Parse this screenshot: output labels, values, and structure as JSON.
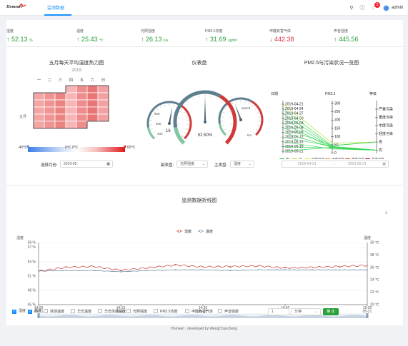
{
  "header": {
    "brand": "Homeeri",
    "nav_tab": "监测数据",
    "user": "admin",
    "notif_count": "5"
  },
  "metrics": [
    {
      "label": "湿度",
      "value": "52.13",
      "unit": "%",
      "trend": "up"
    },
    {
      "label": "温度",
      "value": "25.43",
      "unit": "℃",
      "trend": "up"
    },
    {
      "label": "光照强度",
      "value": "26.13",
      "unit": "lux",
      "trend": "up"
    },
    {
      "label": "PM2.5浓度",
      "value": "31.69",
      "unit": "ug/m³",
      "trend": "up"
    },
    {
      "label": "甲醛有害气体",
      "value": "442.38",
      "unit": "",
      "trend": "down"
    },
    {
      "label": "声音强度",
      "value": "445.56",
      "unit": "",
      "trend": "up"
    }
  ],
  "heatmap": {
    "title": "五月每天平均温度热力图",
    "year": "2019",
    "weekdays": [
      "一",
      "二",
      "三",
      "四",
      "五",
      "六",
      "日"
    ],
    "month_label": "五月",
    "legend_min": "-40℃",
    "legend_mid": "0℃ 0℃",
    "legend_max": "60℃",
    "select_label": "选择月份:",
    "month_value": "2019-05"
  },
  "gauge": {
    "title": "仪表盘",
    "main_value": "52.50%",
    "left_value": "16",
    "right_label": "speed",
    "right_unit": "km",
    "left_ticks": [
      "800",
      "600",
      "400"
    ],
    "sub_label": "副表盘:",
    "sub_value": "光照强度",
    "main_label": "主表盘:",
    "main_select": "湿度"
  },
  "pm": {
    "title": "PM2.5与污染状况一览图",
    "col_date": "日期",
    "col_pm": "PM2.5",
    "col_level": "等级",
    "dates": [
      "2019-04-21",
      "2019-04-24",
      "2019-04-27",
      "2019-04-30",
      "2019-05-03",
      "2019-05-06",
      "2019-05-09",
      "2019-05-12",
      "2019-05-15",
      "2019-05-18",
      "2019-05-21"
    ],
    "pm_ticks": [
      "300",
      "250",
      "200",
      "150",
      "100",
      "50",
      "0"
    ],
    "levels": [
      "严重污染",
      "重度污染",
      "中度污染",
      "轻度污染",
      "良",
      "优"
    ],
    "legend": [
      {
        "name": "优",
        "color": "#28d14a"
      },
      {
        "name": "良",
        "color": "#a8e61d"
      },
      {
        "name": "轻度污染",
        "color": "#f5e71c"
      },
      {
        "name": "中度污染",
        "color": "#f28e1b"
      },
      {
        "name": "重度污染",
        "color": "#e8411d"
      },
      {
        "name": "严重污染",
        "color": "#c0121b"
      }
    ],
    "date_start": "2019-04-21",
    "date_end": "2019-05-21",
    "date_sep": "→"
  },
  "line": {
    "title": "监测数据折线图",
    "legend": [
      "湿度",
      "温度"
    ],
    "left_axis_name": "湿度",
    "right_axis_name": "温度",
    "left_ticks": [
      "58 %",
      "57 %",
      "54 %",
      "51 %",
      "48 %",
      "45 %"
    ],
    "right_ticks": [
      "30 ℃",
      "28 ℃",
      "26 ℃",
      "24 ℃",
      "22 ℃",
      "20 ℃"
    ],
    "x_ticks": [
      {
        "t": "14:00",
        "d": "05-21"
      },
      {
        "t": "14:15",
        "d": "05-21"
      },
      {
        "t": "14:30",
        "d": "05-21"
      },
      {
        "t": "14:45",
        "d": "05-21"
      },
      {
        "t": "15:00",
        "d": "05-21"
      }
    ]
  },
  "chart_data": {
    "type": "line",
    "x": [
      "14:00",
      "14:05",
      "14:10",
      "14:15",
      "14:20",
      "14:25",
      "14:30",
      "14:35",
      "14:40",
      "14:45",
      "14:50",
      "14:55",
      "15:00"
    ],
    "series": [
      {
        "name": "湿度",
        "color": "#c23531",
        "values": [
          52.0,
          52.8,
          53.0,
          52.2,
          52.7,
          53.3,
          52.9,
          53.0,
          53.1,
          52.7,
          52.8,
          53.0,
          53.2
        ]
      },
      {
        "name": "温度",
        "color": "#5a7f96",
        "values": [
          25.4,
          25.5,
          25.5,
          25.3,
          25.5,
          25.6,
          25.6,
          25.5,
          25.6,
          25.6,
          25.6,
          25.6,
          25.6
        ]
      }
    ],
    "ylim": [
      45,
      58
    ],
    "ylim_right": [
      20,
      30
    ]
  },
  "controls": {
    "checkboxes": [
      {
        "label": "湿度",
        "checked": true
      },
      {
        "label": "温度",
        "checked": true
      },
      {
        "label": "体感温度",
        "checked": false
      },
      {
        "label": "华氏温度",
        "checked": false
      },
      {
        "label": "华氏体感温度",
        "checked": false
      },
      {
        "label": "光照强度",
        "checked": false
      },
      {
        "label": "PM2.5浓度",
        "checked": false
      },
      {
        "label": "甲醛有害气体",
        "checked": false
      },
      {
        "label": "声音强度",
        "checked": false
      }
    ],
    "number_value": "1",
    "unit_select": "分钟",
    "confirm": "确 定"
  },
  "footer": "Homeeri . developed by WangChuncheng"
}
